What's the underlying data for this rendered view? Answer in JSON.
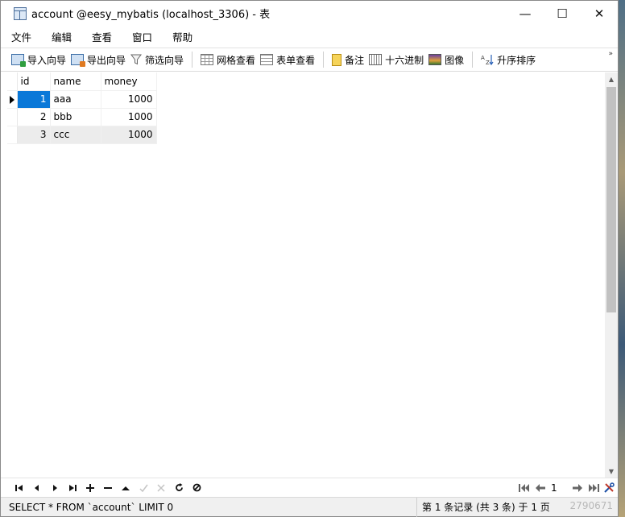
{
  "window": {
    "title": "account @eesy_mybatis (localhost_3306) - 表",
    "controls": {
      "minimize": "—",
      "maximize": "☐",
      "close": "✕"
    }
  },
  "menu": {
    "items": [
      {
        "label": "文件"
      },
      {
        "label": "编辑"
      },
      {
        "label": "查看"
      },
      {
        "label": "窗口"
      },
      {
        "label": "帮助"
      }
    ]
  },
  "toolbar": {
    "import_wizard": "导入向导",
    "export_wizard": "导出向导",
    "filter_wizard": "筛选向导",
    "grid_view": "网格查看",
    "form_view": "表单查看",
    "note": "备注",
    "hex": "十六进制",
    "image": "图像",
    "sort_asc": "升序排序",
    "more": "»"
  },
  "table": {
    "columns": [
      "id",
      "name",
      "money"
    ],
    "rows": [
      {
        "id": "1",
        "name": "aaa",
        "money": "1000"
      },
      {
        "id": "2",
        "name": "bbb",
        "money": "1000"
      },
      {
        "id": "3",
        "name": "ccc",
        "money": "1000"
      }
    ],
    "selected_row": 0
  },
  "navigation": {
    "buttons": [
      "first",
      "previous",
      "next",
      "last",
      "add",
      "delete",
      "up",
      "apply",
      "cancel",
      "refresh",
      "stop"
    ],
    "page_value": "1"
  },
  "status": {
    "sql": "SELECT * FROM `account` LIMIT 0",
    "record_info": "第 1 条记录 (共 3 条) 于 1 页",
    "watermark": "2790671"
  },
  "colors": {
    "selection": "#0a78d8",
    "header_id_bg": "#d8e8f8",
    "alt_row": "#ececec"
  }
}
